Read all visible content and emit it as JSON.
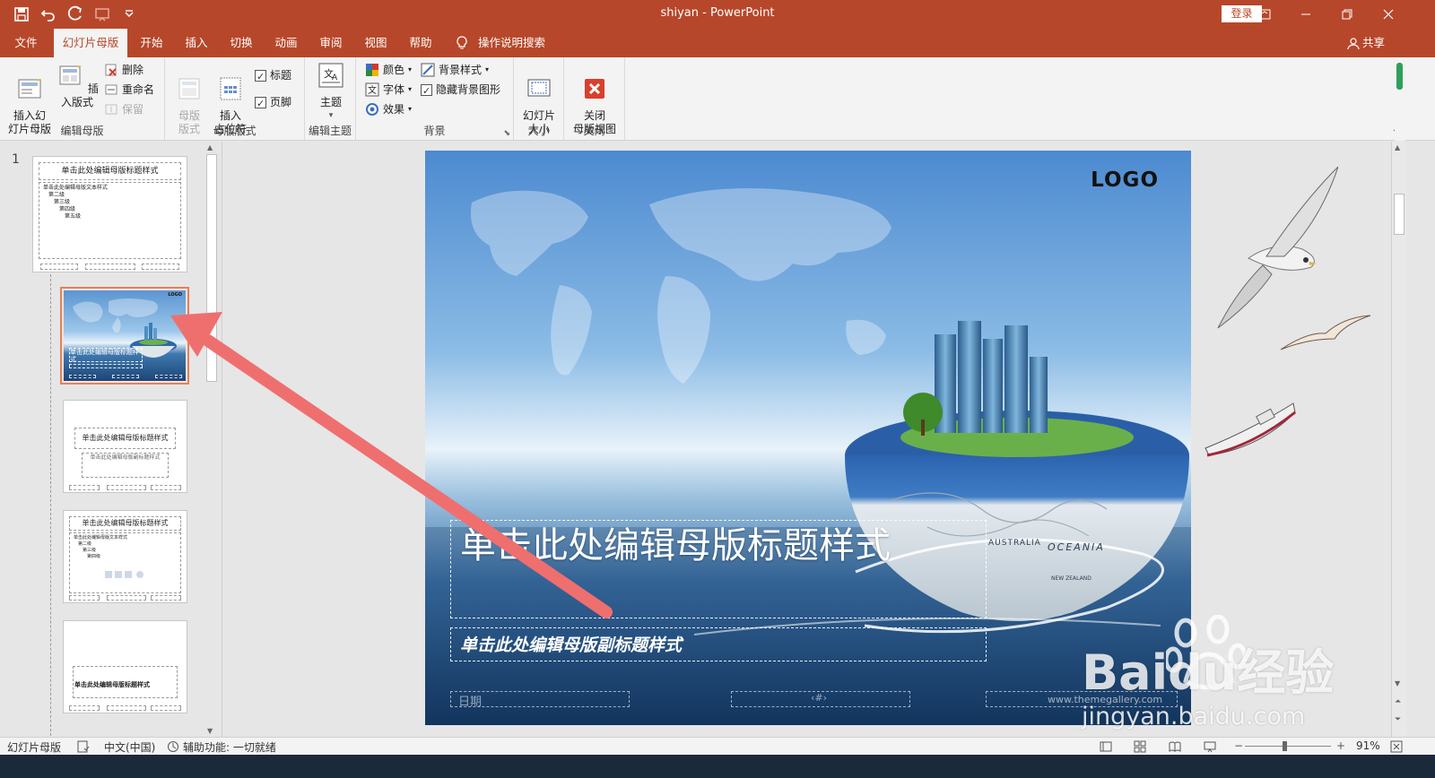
{
  "window": {
    "title": "shiyan  -  PowerPoint",
    "login_label": "登录",
    "controls": [
      "restore-ribbon",
      "minimize",
      "restore",
      "close"
    ]
  },
  "tabs": [
    {
      "label": "文件",
      "active": false
    },
    {
      "label": "幻灯片母版",
      "active": true
    },
    {
      "label": "开始",
      "active": false
    },
    {
      "label": "插入",
      "active": false
    },
    {
      "label": "切换",
      "active": false
    },
    {
      "label": "动画",
      "active": false
    },
    {
      "label": "审阅",
      "active": false
    },
    {
      "label": "视图",
      "active": false
    },
    {
      "label": "帮助",
      "active": false
    }
  ],
  "tell_me": "操作说明搜索",
  "share": "共享",
  "ribbon": {
    "edit_master": {
      "label": "编辑母版",
      "insert_slide_master": "插入幻\n灯片母版",
      "insert_layout": "插入版式",
      "delete": "删除",
      "rename": "重命名",
      "preserve": "保留"
    },
    "master_layout": {
      "label": "母版版式",
      "master_layout_btn": "母版\n版式",
      "insert_placeholder": "插入\n占位符",
      "title_check": "标题",
      "footer_check": "页脚"
    },
    "edit_theme": {
      "label": "编辑主题",
      "themes": "主题"
    },
    "background": {
      "label": "背景",
      "colors": "颜色",
      "fonts": "字体",
      "effects": "效果",
      "bg_styles": "背景样式",
      "hide_bg": "隐藏背景图形"
    },
    "size": {
      "label": "大小",
      "slide_size": "幻灯片\n大小"
    },
    "close": {
      "label": "关闭",
      "close_master": "关闭\n母版视图"
    }
  },
  "thumbnails": {
    "slide_number": "1",
    "master_title": "单击此处编辑母版标题样式",
    "master_body": "单击此处编辑母版文本样式",
    "level2": "第二级",
    "level3": "第三级",
    "level4": "第四级",
    "level5": "第五级",
    "layout2_title": "单击此处编辑母版标题样式",
    "layout2_sub": "单击此处编辑母版副标题样式",
    "layout3_title": "单击此处编辑母版标题样式",
    "layout3_body": "单击此处编辑母版文本样式",
    "layout4_title": "单击此处编辑母版标题样式",
    "thumb_logo": "LOGO",
    "thumb_title": "单击此处编辑母版标题样式"
  },
  "slide": {
    "logo": "LOGO",
    "title": "单击此处编辑母版标题样式",
    "subtitle": "单击此处编辑母版副标题样式",
    "date": "日期",
    "page": "‹#›",
    "map_labels": [
      "AUSTRALIA",
      "OCEANIA",
      "NEW ZEALAND"
    ],
    "credit": "www.themegallery.com"
  },
  "status": {
    "view": "幻灯片母版",
    "language": "中文(中国)",
    "accessibility": "辅助功能: 一切就绪",
    "zoom": "91%"
  },
  "watermark": {
    "brand": "Baidu经验",
    "url": "jingyan.baidu.com"
  },
  "colors": {
    "accent": "#b7472a",
    "ribbon_bg": "#f3f3f3",
    "arrow": "#ef6f6f",
    "selection": "#e0805f"
  }
}
